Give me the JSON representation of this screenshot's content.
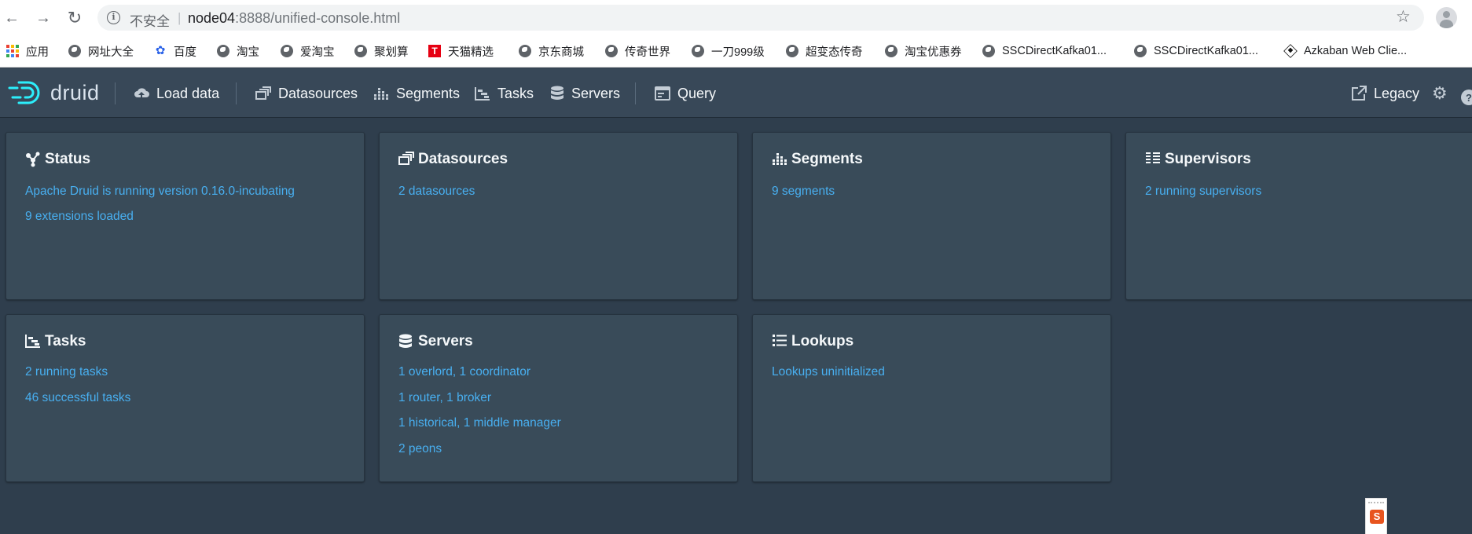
{
  "browser": {
    "insecure_label": "不安全",
    "url_host": "node04",
    "url_rest": ":8888/unified-console.html"
  },
  "bookmarks": [
    {
      "label": "应用",
      "icon": "apps-grid-icon"
    },
    {
      "label": "网址大全",
      "icon": "globe-icon"
    },
    {
      "label": "百度",
      "icon": "baidu-paw-icon"
    },
    {
      "label": "淘宝",
      "icon": "globe-icon"
    },
    {
      "label": "爱淘宝",
      "icon": "globe-icon"
    },
    {
      "label": "聚划算",
      "icon": "globe-icon"
    },
    {
      "label": "天猫精选",
      "icon": "tmall-icon"
    },
    {
      "label": "京东商城",
      "icon": "globe-icon"
    },
    {
      "label": "传奇世界",
      "icon": "globe-icon"
    },
    {
      "label": "一刀999级",
      "icon": "globe-icon"
    },
    {
      "label": "超变态传奇",
      "icon": "globe-icon"
    },
    {
      "label": "淘宝优惠券",
      "icon": "globe-icon"
    },
    {
      "label": "SSCDirectKafka01...",
      "icon": "globe-icon"
    },
    {
      "label": "SSCDirectKafka01...",
      "icon": "globe-icon"
    },
    {
      "label": "Azkaban Web Clie...",
      "icon": "azkaban-icon"
    }
  ],
  "nav": {
    "logo": "druid",
    "load_data": "Load data",
    "datasources": "Datasources",
    "segments": "Segments",
    "tasks": "Tasks",
    "servers": "Servers",
    "query": "Query",
    "legacy": "Legacy"
  },
  "cards": {
    "status": {
      "title": "Status",
      "lines": [
        "Apache Druid is running version 0.16.0-incubating",
        "9 extensions loaded"
      ]
    },
    "datasources": {
      "title": "Datasources",
      "lines": [
        "2 datasources"
      ]
    },
    "segments": {
      "title": "Segments",
      "lines": [
        "9 segments"
      ]
    },
    "supervisors": {
      "title": "Supervisors",
      "lines": [
        "2 running supervisors"
      ]
    },
    "tasks": {
      "title": "Tasks",
      "lines": [
        "2 running tasks",
        "46 successful tasks"
      ]
    },
    "servers": {
      "title": "Servers",
      "lines": [
        "1 overlord, 1 coordinator",
        "1 router, 1 broker",
        "1 historical, 1 middle manager",
        "2 peons"
      ]
    },
    "lookups": {
      "title": "Lookups",
      "lines": [
        "Lookups uninitialized"
      ]
    }
  },
  "widget": {
    "letter": "S"
  },
  "colors": {
    "header_bg": "#384858",
    "page_bg": "#2f3e4d",
    "card_bg": "#394b59",
    "link": "#48aff0",
    "logo_accent": "#2ceefb"
  }
}
